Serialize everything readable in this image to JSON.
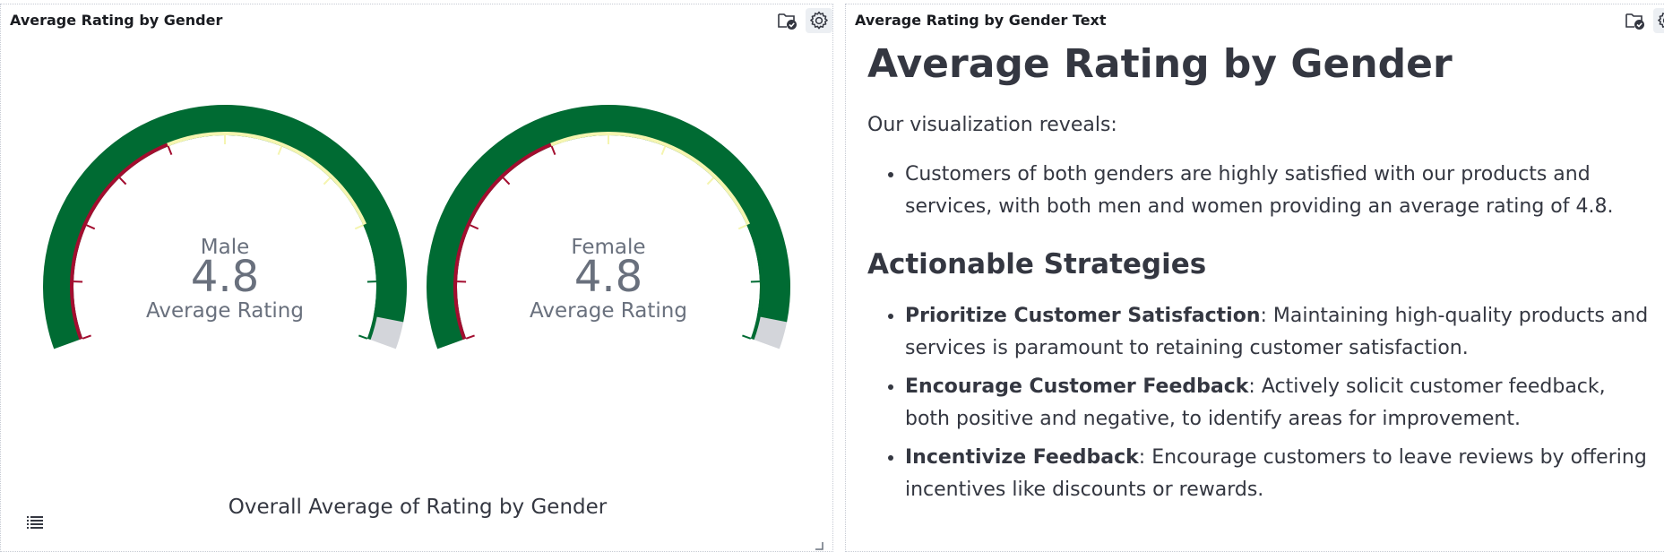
{
  "left_panel": {
    "title": "Average Rating by Gender",
    "caption": "Overall Average of Rating by Gender",
    "icons": [
      "folder-check-icon",
      "gear-icon"
    ],
    "legend_icon": "list-icon"
  },
  "right_panel": {
    "title": "Average Rating by Gender Text",
    "icons": [
      "folder-check-icon",
      "gear-icon"
    ],
    "heading": "Average Rating by Gender",
    "intro": "Our visualization reveals:",
    "bullets": [
      "Customers of both genders are highly satisfied with our products and services, with both men and women providing an average rating of 4.8."
    ],
    "subheading": "Actionable Strategies",
    "strategies": [
      {
        "title": "Prioritize Customer Satisfaction",
        "text": ": Maintaining high-quality products and services is paramount to retaining customer satisfaction."
      },
      {
        "title": "Encourage Customer Feedback",
        "text": ": Actively solicit customer feedback, both positive and negative, to identify areas for improvement."
      },
      {
        "title": "Incentivize Feedback",
        "text": ": Encourage customers to leave reviews by offering incentives like discounts or rewards."
      }
    ]
  },
  "chart_data": {
    "type": "gauge",
    "title": "Overall Average of Rating by Gender",
    "range": [
      0,
      5
    ],
    "bands": [
      {
        "from": 0,
        "to": 2,
        "color": "#a30d2f"
      },
      {
        "from": 2,
        "to": 4,
        "color": "#f5f5b0"
      },
      {
        "from": 4,
        "to": 5,
        "color": "#006b33"
      }
    ],
    "value_color": "#006b33",
    "track_color": "#d3d5da",
    "gauges": [
      {
        "category": "Male",
        "value": 4.8,
        "label": "4.8",
        "sublabel": "Average Rating"
      },
      {
        "category": "Female",
        "value": 4.8,
        "label": "4.8",
        "sublabel": "Average Rating"
      }
    ]
  }
}
